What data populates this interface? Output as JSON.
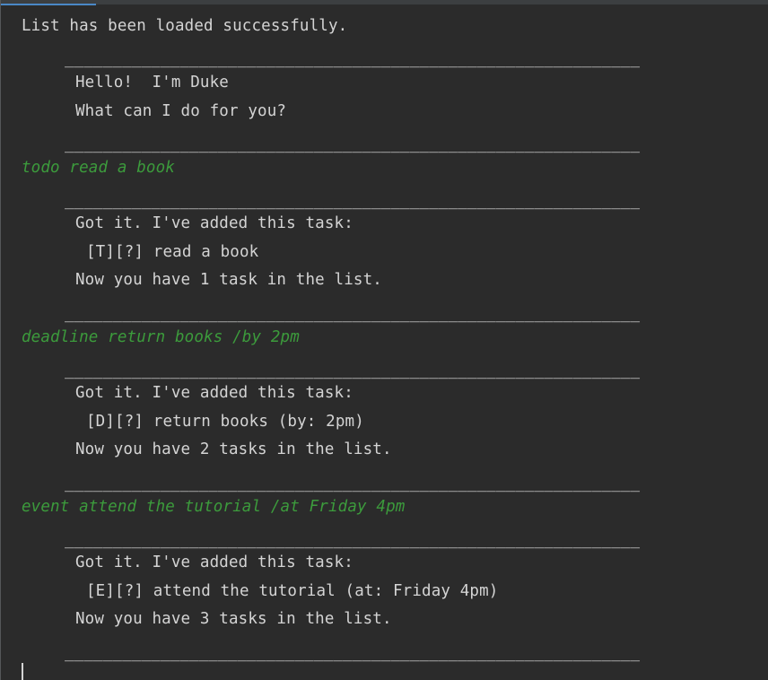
{
  "console": {
    "status_message": "List has been loaded successfully.",
    "separator": "____________________________________________________________",
    "greeting": {
      "line1": "Hello!  I'm Duke",
      "line2": "What can I do for you?"
    },
    "exchanges": [
      {
        "input": "todo read a book",
        "ack": "Got it. I've added this task:",
        "task": "[T][?] read a book",
        "count": "Now you have 1 task in the list."
      },
      {
        "input": "deadline return books /by 2pm",
        "ack": "Got it. I've added this task:",
        "task": "[D][?] return books (by: 2pm)",
        "count": "Now you have 2 tasks in the list."
      },
      {
        "input": "event attend the tutorial /at Friday 4pm",
        "ack": "Got it. I've added this task:",
        "task": "[E][?] attend the tutorial (at: Friday 4pm)",
        "count": "Now you have 3 tasks in the list."
      }
    ]
  },
  "colors": {
    "background": "#2b2b2b",
    "output_text": "#d4d4d4",
    "user_input_text": "#3c9b3c",
    "accent": "#4a88c7"
  }
}
